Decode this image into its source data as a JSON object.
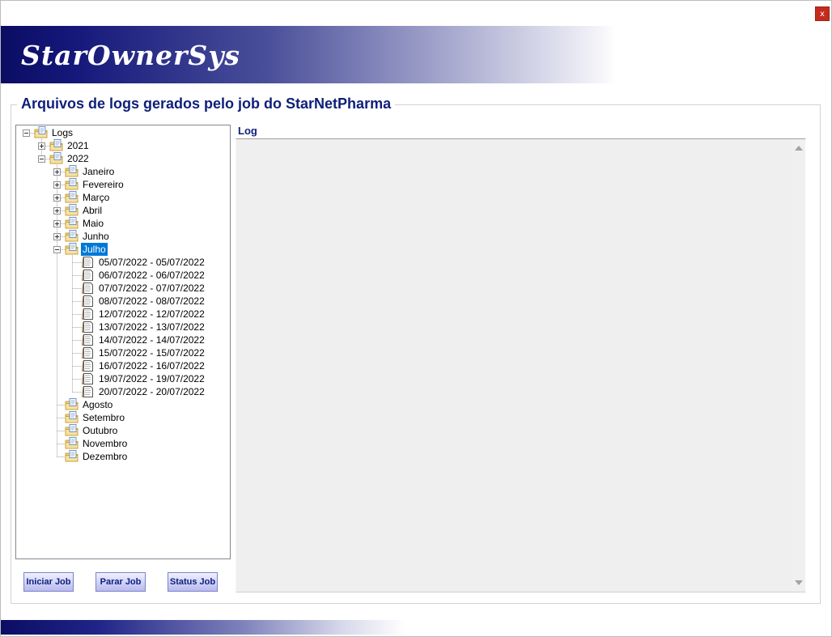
{
  "window": {
    "close_label": "x"
  },
  "banner": {
    "title": "StarOwnerSys"
  },
  "group": {
    "title": "Arquivos de logs gerados pelo job do StarNetPharma"
  },
  "log": {
    "label": "Log",
    "content": ""
  },
  "buttons": {
    "start": "Iniciar Job",
    "stop": "Parar Job",
    "status": "Status Job"
  },
  "colors": {
    "accent": "#0e1f7a",
    "banner_dark": "#0b0d63",
    "selection": "#0078d7",
    "close": "#c42b1c"
  },
  "tree": {
    "root": "Logs",
    "years": [
      {
        "label": "2021",
        "expanded": false
      },
      {
        "label": "2022",
        "expanded": true
      }
    ],
    "months": [
      {
        "label": "Janeiro",
        "expander": "plus"
      },
      {
        "label": "Fevereiro",
        "expander": "plus"
      },
      {
        "label": "Março",
        "expander": "plus"
      },
      {
        "label": "Abril",
        "expander": "plus"
      },
      {
        "label": "Maio",
        "expander": "plus"
      },
      {
        "label": "Junho",
        "expander": "plus"
      },
      {
        "label": "Julho",
        "expander": "minus",
        "selected": true
      },
      {
        "label": "Agosto",
        "expander": "none"
      },
      {
        "label": "Setembro",
        "expander": "none"
      },
      {
        "label": "Outubro",
        "expander": "none"
      },
      {
        "label": "Novembro",
        "expander": "none"
      },
      {
        "label": "Dezembro",
        "expander": "none"
      }
    ],
    "july_files": [
      "05/07/2022 - 05/07/2022",
      "06/07/2022 - 06/07/2022",
      "07/07/2022 - 07/07/2022",
      "08/07/2022 - 08/07/2022",
      "12/07/2022 - 12/07/2022",
      "13/07/2022 - 13/07/2022",
      "14/07/2022 - 14/07/2022",
      "15/07/2022 - 15/07/2022",
      "16/07/2022 - 16/07/2022",
      "19/07/2022 - 19/07/2022",
      "20/07/2022 - 20/07/2022"
    ]
  }
}
